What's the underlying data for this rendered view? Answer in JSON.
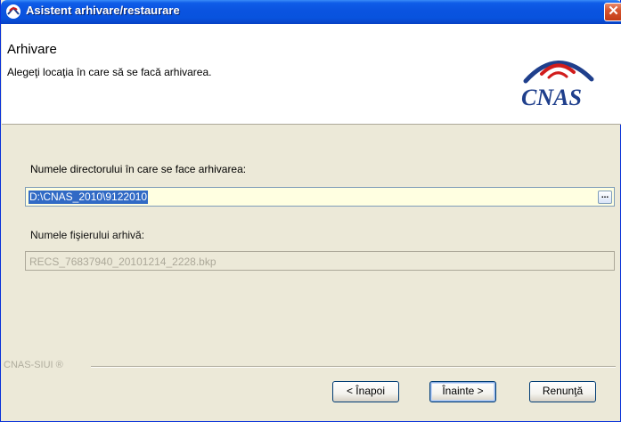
{
  "window": {
    "title": "Asistent arhivare/restaurare",
    "close_glyph": "✕"
  },
  "header": {
    "title": "Arhivare",
    "subtitle": "Alegeţi locaţia în care să se facă arhivarea.",
    "logo_text": "CNAS"
  },
  "form": {
    "dir_label": "Numele directorului în care se face arhivarea:",
    "dir_value": "D:\\CNAS_2010\\9122010",
    "browse_label": "...",
    "file_label": "Numele fişierului arhivă:",
    "file_value": "RECS_76837940_20101214_2228.bkp"
  },
  "footer": {
    "brand": "CNAS-SIUI ®",
    "back_label": "< Înapoi",
    "next_label": "Înainte >",
    "cancel_label": "Renunţă"
  },
  "colors": {
    "titlebar": "#0853de",
    "selection": "#316ac5",
    "input_bg": "#ffffe1",
    "window_bg": "#ece9d8",
    "logo": "#1f3f8c",
    "logo_accent": "#d11c1c"
  }
}
